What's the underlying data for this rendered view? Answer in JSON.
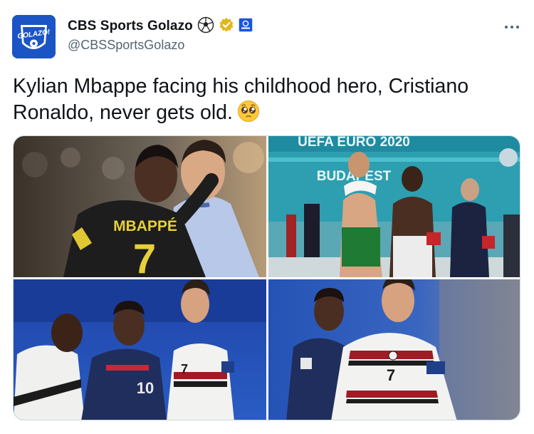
{
  "author": {
    "name": "CBS Sports Golazo",
    "handle": "@CBSSportsGolazo",
    "avatar_text": "GOLAZO!",
    "icons": [
      "soccer-ball-icon",
      "verified-gold-badge-icon",
      "affiliate-badge-icon"
    ]
  },
  "menu": {
    "icon": "more-horizontal-icon"
  },
  "tweet": {
    "text_line1": "Kylian Mbappe facing his childhood hero, Cristiano",
    "text_line2": "Ronaldo, never gets old.",
    "emoji": "pleading-face-emoji"
  },
  "media": {
    "photo1": {
      "jersey_name": "MBAPPÉ",
      "jersey_number": "7"
    },
    "photo2": {
      "banner": "UEFA EURO 2020",
      "wall_text": "BUDAPEST"
    },
    "photo3": {
      "jersey_number_blue": "10",
      "jersey_number_white": "7"
    },
    "photo4": {
      "jersey_number_white": "7"
    }
  },
  "colors": {
    "text": "#0f1419",
    "secondary": "#536471",
    "avatar_bg": "#1b54c4",
    "verified_gold": "#e2b719",
    "france_blue": "#1f2e5c",
    "portugal_white": "#f2f2f0"
  }
}
